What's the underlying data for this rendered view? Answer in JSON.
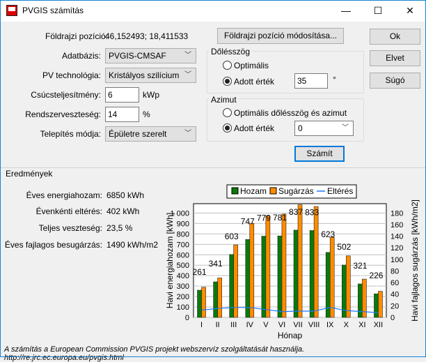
{
  "window": {
    "title": "PVGIS számítás",
    "minimize": "—",
    "maximize": "☐",
    "close": "✕"
  },
  "form": {
    "position_label": "Földrajzi pozíció:",
    "position_value": "46,152493; 18,411533",
    "db_label": "Adatbázis:",
    "db_value": "PVGIS-CMSAF",
    "tech_label": "PV technológia:",
    "tech_value": "Kristályos szilícium",
    "peak_label": "Csúcsteljesítmény:",
    "peak_value": "6",
    "peak_unit": "kWp",
    "loss_label": "Rendszerveszteség:",
    "loss_value": "14",
    "loss_unit": "%",
    "mount_label": "Telepítés módja:",
    "mount_value": "Épületre szerelt",
    "change_pos_button": "Földrajzi pozíció módosítása...",
    "tilt": {
      "title": "Dőlésszög",
      "opt_label": "Optimális",
      "fixed_label": "Adott érték",
      "value": "35",
      "unit": "°",
      "selected": "fixed"
    },
    "azimuth": {
      "title": "Azimut",
      "opt_label": "Optimális dőlésszög és azimut",
      "fixed_label": "Adott érték",
      "value": "0",
      "selected": "fixed"
    },
    "calc_button": "Számít"
  },
  "buttons": {
    "ok": "Ok",
    "cancel": "Elvet",
    "help": "Súgó"
  },
  "results": {
    "title": "Eredmények",
    "annual_label": "Éves energiahozam:",
    "annual_value": "6850 kWh",
    "dev_label": "Évenkénti eltérés:",
    "dev_value": "402 kWh",
    "loss_label": "Teljes veszteség:",
    "loss_value": "23,5 %",
    "irr_label": "Éves fajlagos besugárzás:",
    "irr_value": "1490 kWh/m2"
  },
  "footer": "A számítás a European Commission PVGIS projekt webszervíz szolgáltatását használja. http://re.jrc.ec.europa.eu/pvgis.html",
  "chart_data": {
    "type": "bar",
    "categories": [
      "I",
      "II",
      "III",
      "IV",
      "V",
      "VI",
      "VII",
      "VIII",
      "IX",
      "X",
      "XI",
      "XII"
    ],
    "series": [
      {
        "name": "Hozam",
        "axis": "left",
        "color": "#0a7a0a",
        "values": [
          261,
          341,
          603,
          747,
          779,
          781,
          837,
          833,
          623,
          502,
          321,
          226
        ]
      },
      {
        "name": "Sugárzás",
        "axis": "right",
        "color": "#ff8c00",
        "values": [
          52,
          68,
          125,
          162,
          175,
          178,
          194,
          191,
          138,
          106,
          66,
          45
        ]
      },
      {
        "name": "Eltérés",
        "axis": "left",
        "type": "line",
        "color": "#1e78ff",
        "values": [
          70,
          85,
          95,
          95,
          75,
          55,
          60,
          60,
          95,
          65,
          55,
          45
        ]
      }
    ],
    "xlabel": "Hónap",
    "ylabel": "Havi energiahozam [kWh]",
    "y2label": "Havi fajlagos sugárzás [kWh/m2]",
    "ylim": [
      0,
      1090
    ],
    "y2lim": [
      0,
      196
    ],
    "yticks": [
      "0",
      "100",
      "200",
      "300",
      "400",
      "500",
      "600",
      "700",
      "800",
      "900",
      "1 000"
    ],
    "y2ticks": [
      "0",
      "20",
      "40",
      "60",
      "80",
      "100",
      "120",
      "140",
      "160",
      "180"
    ],
    "legend": "top"
  }
}
